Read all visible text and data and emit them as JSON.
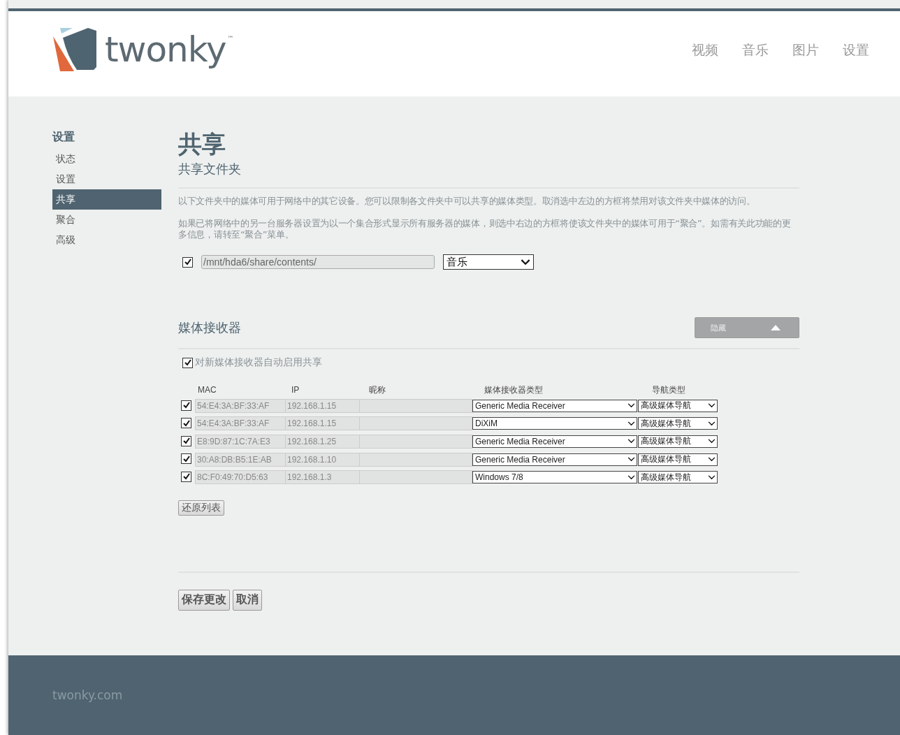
{
  "header": {
    "logo_text": "twonky",
    "logo_mark": "™",
    "nav": [
      {
        "label": "视频",
        "selected": false
      },
      {
        "label": "音乐",
        "selected": false
      },
      {
        "label": "图片",
        "selected": false
      },
      {
        "label": "设置",
        "selected": false
      }
    ]
  },
  "sidebar": {
    "title": "设置",
    "items": [
      {
        "label": "状态",
        "selected": false
      },
      {
        "label": "设置",
        "selected": false
      },
      {
        "label": "共享",
        "selected": true
      },
      {
        "label": "聚合",
        "selected": false
      },
      {
        "label": "高级",
        "selected": false
      }
    ]
  },
  "page": {
    "title": "共享",
    "subtitle": "共享文件夹",
    "paragraphs": [
      "以下文件夹中的媒体可用于网络中的其它设备。您可以限制各文件夹中可以共享的媒体类型。取消选中左边的方框将禁用对该文件夹中媒体的访问。",
      "如果已将网络中的另一台服务器设置为以一个集合形式显示所有服务器的媒体，则选中右边的方框将使该文件夹中的媒体可用于“聚合”。如需有关此功能的更多信息，请转至“聚合”菜单。"
    ],
    "folders": [
      {
        "checked": true,
        "path": "/mnt/hda6/share/contents/",
        "media_type": "音乐"
      }
    ]
  },
  "receivers": {
    "title": "媒体接收器",
    "hide_button": "隐藏",
    "auto_share": {
      "label": "对新媒体接收器自动启用共享",
      "checked": true
    },
    "columns": [
      "MAC",
      "IP",
      "昵称",
      "媒体接收器类型",
      "导航类型"
    ],
    "rows": [
      {
        "checked": true,
        "mac": "54:E4:3A:BF:33:AF",
        "ip": "192.168.1.15",
        "type": "Generic Media Receiver",
        "nav": "高级媒体导航"
      },
      {
        "checked": true,
        "mac": "54:E4:3A:BF:33:AF",
        "ip": "192.168.1.15",
        "type": "DiXiM",
        "nav": "高级媒体导航"
      },
      {
        "checked": true,
        "mac": "E8:9D:87:1C:7A:E3",
        "ip": "192.168.1.25",
        "type": "Generic Media Receiver",
        "nav": "高级媒体导航"
      },
      {
        "checked": true,
        "mac": "30:A8:DB:B5:1E:AB",
        "ip": "192.168.1.10",
        "type": "Generic Media Receiver",
        "nav": "高级媒体导航"
      },
      {
        "checked": true,
        "mac": "8C:F0:49:70:D5:63",
        "ip": "192.168.1.3",
        "type": "Windows 7/8",
        "nav": "高级媒体导航"
      }
    ],
    "reset_button": "还原列表"
  },
  "actions": [
    "保存更改",
    "取消"
  ],
  "footer": {
    "text": "twonky.com"
  }
}
